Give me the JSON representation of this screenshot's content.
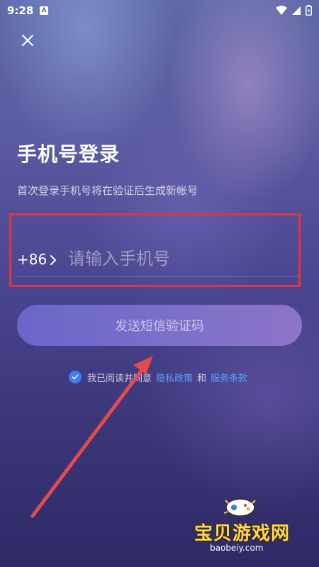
{
  "status_bar": {
    "time": "9:28",
    "notification_badge": "A"
  },
  "login": {
    "title": "手机号登录",
    "subtitle": "首次登录手机号将在验证后生成新帐号",
    "country_code": "+86",
    "phone_placeholder": "请输入手机号",
    "phone_value": "",
    "send_code_label": "发送短信验证码"
  },
  "agreement": {
    "checked": true,
    "prefix": "我已阅读并同意",
    "privacy_link": "隐私政策",
    "conjunction": "和",
    "terms_link": "服务条款"
  },
  "watermark": {
    "name": "宝贝游戏网",
    "url": "baobeiy.com"
  },
  "colors": {
    "highlight_box": "#e8323c",
    "annotation_arrow": "#e8494f",
    "link": "#5aa2ff",
    "checkbox": "#3f7bff"
  },
  "icons": {
    "close": "close-icon",
    "chevron": "chevron-right-icon",
    "check": "check-icon",
    "wifi": "wifi-icon",
    "signal": "signal-icon",
    "battery": "battery-icon"
  }
}
